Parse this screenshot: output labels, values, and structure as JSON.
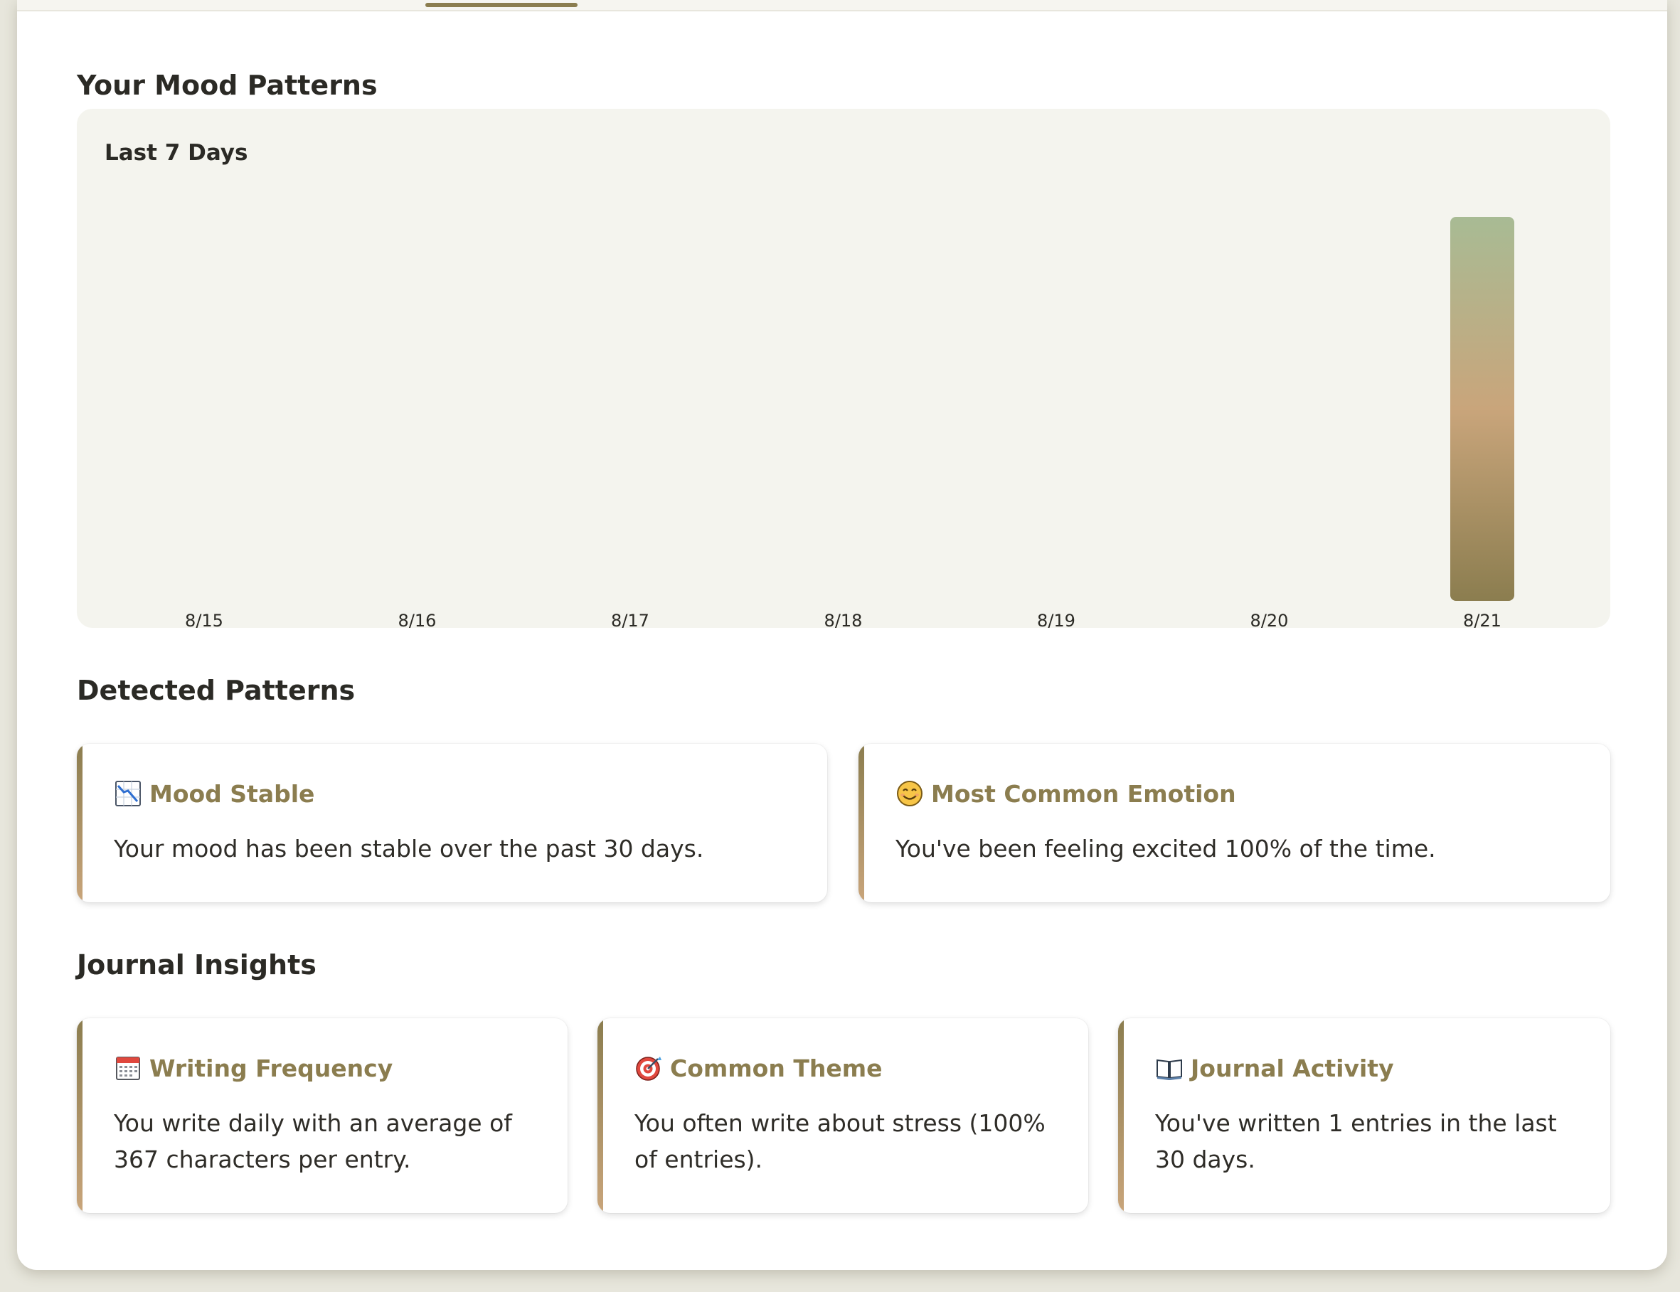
{
  "sections": {
    "mood_title": "Your Mood Patterns",
    "patterns_title": "Detected Patterns",
    "insights_title": "Journal Insights"
  },
  "chart_data": {
    "type": "bar",
    "title": "Last 7 Days",
    "categories": [
      "8/15",
      "8/16",
      "8/17",
      "8/18",
      "8/19",
      "8/20",
      "8/21"
    ],
    "values": [
      0,
      0,
      0,
      0,
      0,
      0,
      1
    ],
    "ylim": [
      0,
      1
    ],
    "grid": false,
    "bar_gradient": [
      "#a8bb94",
      "#c9a57b",
      "#8b7d4f"
    ]
  },
  "patterns": [
    {
      "icon": "chart-decreasing-icon",
      "title": "Mood Stable",
      "text": "Your mood has been stable over the past 30 days."
    },
    {
      "icon": "smiling-face-icon",
      "title": "Most Common Emotion",
      "text": "You've been feeling excited 100% of the time."
    }
  ],
  "insights": [
    {
      "icon": "calendar-icon",
      "title": "Writing Frequency",
      "text": "You write daily with an average of 367 characters per entry."
    },
    {
      "icon": "target-icon",
      "title": "Common Theme",
      "text": "You often write about stress (100% of entries)."
    },
    {
      "icon": "open-book-icon",
      "title": "Journal Activity",
      "text": "You've written 1 entries in the last 30 days."
    }
  ],
  "colors": {
    "accent": "#8b7d4f",
    "accent_light": "#c9a57b",
    "panel": "#f4f4ee",
    "background": "#e7e6dc"
  }
}
